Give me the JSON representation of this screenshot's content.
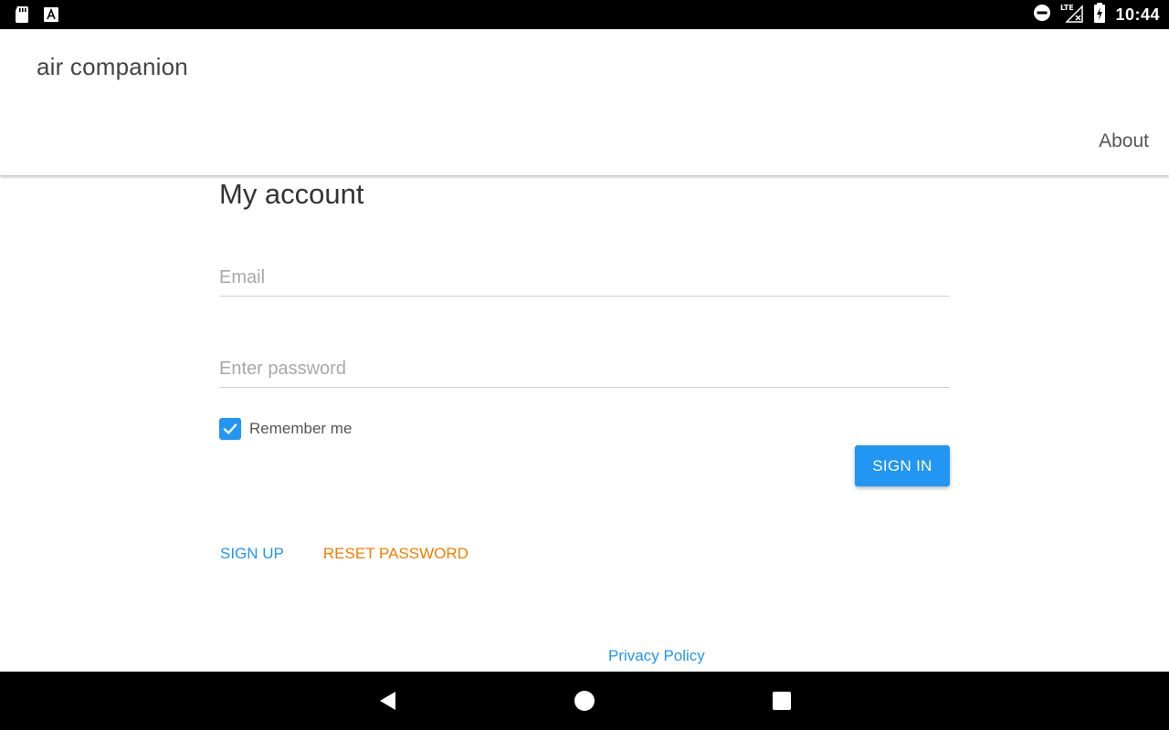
{
  "status_bar": {
    "time": "10:44",
    "network_label": "LTE",
    "icons": [
      "sd-card-icon",
      "text-a-icon",
      "do-not-disturb-icon",
      "signal-lte-icon",
      "battery-charging-icon"
    ]
  },
  "app_bar": {
    "title": "air companion",
    "about_label": "About"
  },
  "account": {
    "title": "My account",
    "email_placeholder": "Email",
    "email_value": "",
    "password_placeholder": "Enter password",
    "password_value": "",
    "remember_label": "Remember me",
    "remember_checked": true,
    "sign_in_label": "SIGN IN",
    "sign_up_label": "SIGN UP",
    "reset_password_label": "RESET PASSWORD"
  },
  "footer": {
    "privacy_label": "Privacy Policy"
  },
  "nav_bar": {
    "icons": [
      "back-icon",
      "home-icon",
      "recents-icon"
    ]
  },
  "colors": {
    "accent": "#2196f3",
    "reset_link": "#f57c00",
    "system_bars": "#000000"
  }
}
